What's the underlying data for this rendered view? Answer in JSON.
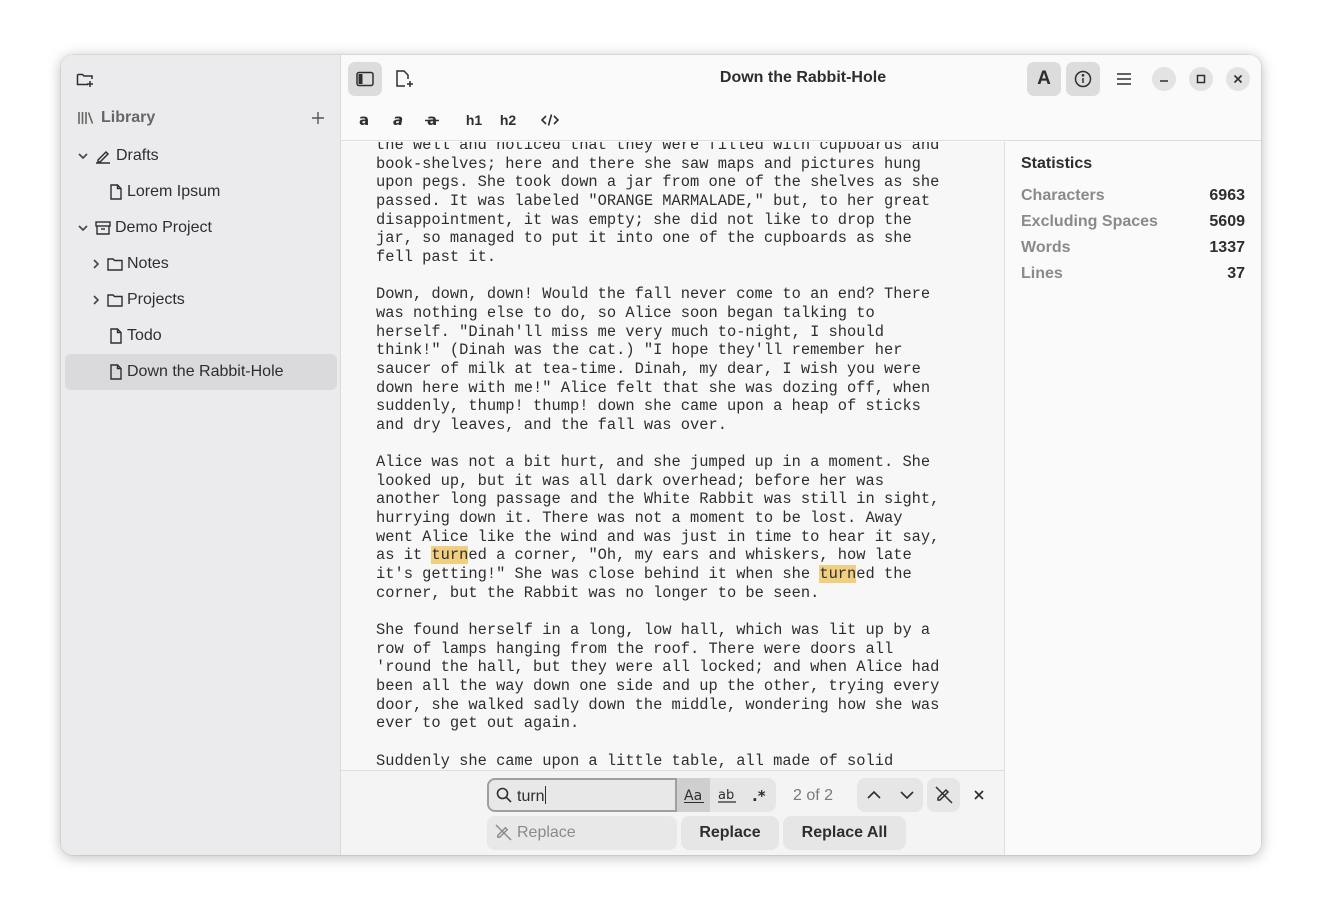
{
  "window": {
    "title": "Down the Rabbit-Hole"
  },
  "sidebar": {
    "library_label": "Library",
    "tree": [
      {
        "label": "Drafts",
        "type": "notebook",
        "expanded": true,
        "level": 0
      },
      {
        "label": "Lorem Ipsum",
        "type": "file",
        "level": 1
      },
      {
        "label": "Demo Project",
        "type": "project",
        "expanded": true,
        "level": 0
      },
      {
        "label": "Notes",
        "type": "folder",
        "expanded": false,
        "level": 1
      },
      {
        "label": "Projects",
        "type": "folder",
        "expanded": false,
        "level": 1
      },
      {
        "label": "Todo",
        "type": "file",
        "level": 1
      },
      {
        "label": "Down the Rabbit-Hole",
        "type": "file",
        "level": 1,
        "selected": true
      }
    ]
  },
  "format_toolbar": {
    "h1": "h1",
    "h2": "h2"
  },
  "editor": {
    "lines": [
      "the well and noticed that they were filled with cupboards and",
      "book-shelves; here and there she saw maps and pictures hung",
      "upon pegs. She took down a jar from one of the shelves as she",
      "passed. It was labeled \"ORANGE MARMALADE,\" but, to her great",
      "disappointment, it was empty; she did not like to drop the",
      "jar, so managed to put it into one of the cupboards as she",
      "fell past it.",
      "",
      "Down, down, down! Would the fall never come to an end? There",
      "was nothing else to do, so Alice soon began talking to",
      "herself. \"Dinah'll miss me very much to-night, I should",
      "think!\" (Dinah was the cat.) \"I hope they'll remember her",
      "saucer of milk at tea-time. Dinah, my dear, I wish you were",
      "down here with me!\" Alice felt that she was dozing off, when",
      "suddenly, thump! thump! down she came upon a heap of sticks",
      "and dry leaves, and the fall was over.",
      "",
      "Alice was not a bit hurt, and she jumped up in a moment. She",
      "looked up, but it was all dark overhead; before her was",
      "another long passage and the White Rabbit was still in sight,",
      "hurrying down it. There was not a moment to be lost. Away",
      "went Alice like the wind and was just in time to hear it say,",
      "as it turned a corner, \"Oh, my ears and whiskers, how late",
      "it's getting!\" She was close behind it when she turned the",
      "corner, but the Rabbit was no longer to be seen.",
      "",
      "She found herself in a long, low hall, which was lit up by a",
      "row of lamps hanging from the roof. There were doors all",
      "'round the hall, but they were all locked; and when Alice had",
      "been all the way down one side and up the other, trying every",
      "door, she walked sadly down the middle, wondering how she was",
      "ever to get out again.",
      "",
      "Suddenly she came upon a little table, all made of solid"
    ],
    "highlight_term": "turn",
    "highlight_color": "#f0cf80"
  },
  "statistics": {
    "title": "Statistics",
    "rows": [
      {
        "label": "Characters",
        "value": "6963"
      },
      {
        "label": "Excluding Spaces",
        "value": "5609"
      },
      {
        "label": "Words",
        "value": "1337"
      },
      {
        "label": "Lines",
        "value": "37"
      }
    ]
  },
  "search": {
    "query": "turn",
    "match_count": "2 of 2",
    "replace_placeholder": "Replace",
    "replace_label": "Replace",
    "replace_all_label": "Replace All",
    "case_sensitive": true
  }
}
